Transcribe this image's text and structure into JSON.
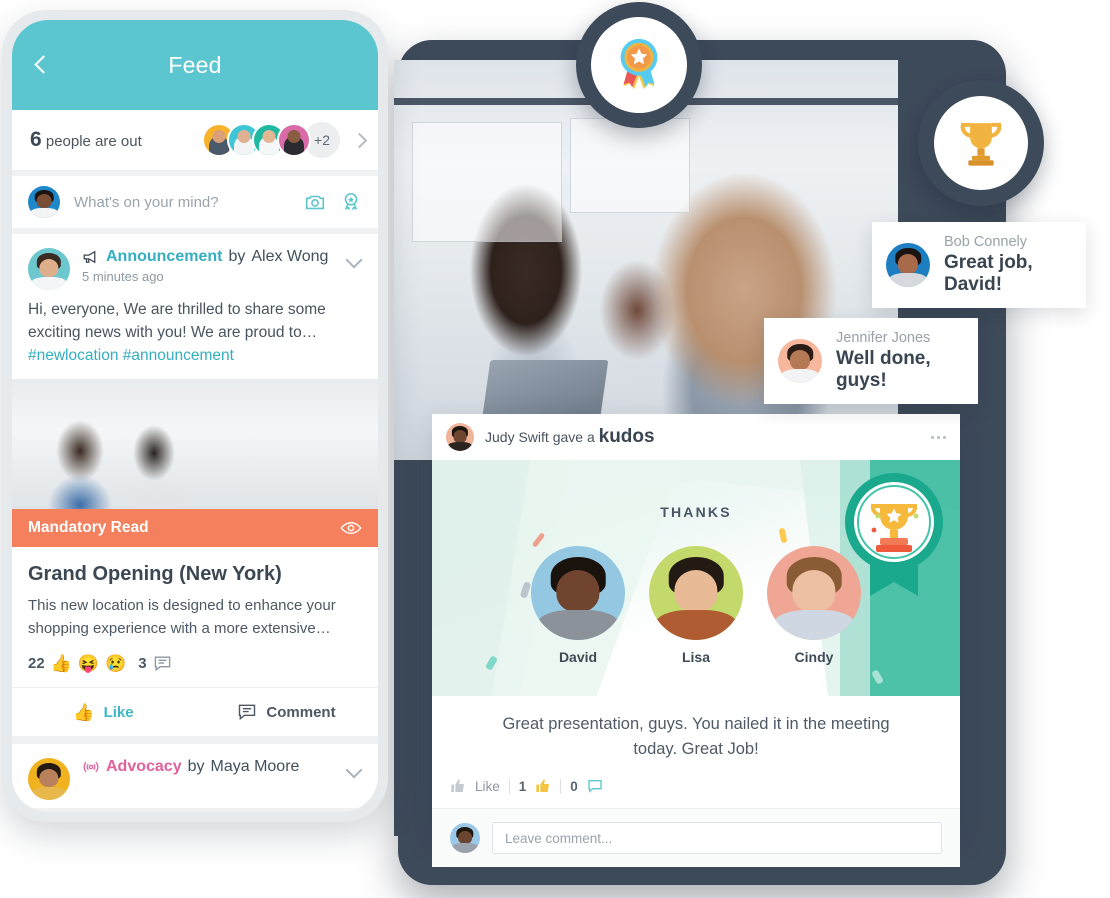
{
  "phone": {
    "header": {
      "title": "Feed",
      "back_icon": "chevron-left-icon"
    },
    "out_of_office": {
      "count": "6",
      "label": "people are out",
      "more_badge": "+2",
      "chevron_icon": "chevron-right-icon",
      "avatars": [
        {
          "name": "avatar-1",
          "bg": "#f7b32b",
          "skin": "#d9a07a",
          "hair": "#2f2620",
          "body": "#4a5a6b"
        },
        {
          "name": "avatar-2",
          "bg": "#3ec6d4",
          "skin": "#e0b093",
          "hair": "#2a211c",
          "body": "#f2f4f6"
        },
        {
          "name": "avatar-3",
          "bg": "#1fb8a0",
          "skin": "#e4b694",
          "hair": "#3b2f26",
          "body": "#f4f6f7"
        },
        {
          "name": "avatar-4",
          "bg": "#d96ca8",
          "skin": "#8a5c42",
          "hair": "#1d1714",
          "body": "#2b2a30"
        }
      ]
    },
    "composer": {
      "placeholder": "What's on your mind?",
      "camera_icon": "camera-icon",
      "badge_icon": "award-badge-icon"
    },
    "posts": [
      {
        "kind": "Announcement",
        "kind_class": "ann",
        "by_label": "by",
        "author": "Alex Wong",
        "time": "5 minutes ago",
        "icon": "megaphone-icon",
        "chevron_icon": "chevron-down-icon",
        "body": "Hi, everyone, We are thrilled to share some exciting news with you! We are proud to…",
        "tags": "#newlocation #announcement",
        "banner_label": "Mandatory Read",
        "banner_icon": "eye-icon",
        "banner_color": "#f5805e",
        "title": "Grand Opening (New York)",
        "subtitle": "This new location is designed to enhance your shopping experience with a more extensive…",
        "reaction_count": "22",
        "reaction_emojis": [
          "👍",
          "😝",
          "😢"
        ],
        "comment_count": "3",
        "comment_icon": "comment-icon",
        "like_label": "Like",
        "comment_label": "Comment"
      },
      {
        "kind": "Advocacy",
        "kind_class": "adv",
        "by_label": "by",
        "author": "Maya Moore",
        "icon": "broadcast-icon",
        "chevron_icon": "chevron-down-icon"
      }
    ]
  },
  "kudos_card": {
    "header": {
      "actor": "Judy Swift gave a",
      "type": "kudos",
      "menu_icon": "more-options-icon"
    },
    "banner": {
      "label": "THANKS",
      "badge_icon": "trophy-ribbon-badge-icon",
      "badge_color": "#1aa98c"
    },
    "recipients": [
      {
        "name": "David",
        "bg": "#93c7e2",
        "skin": "#70442e",
        "hair": "#1a120d",
        "body": "#8b929a"
      },
      {
        "name": "Lisa",
        "bg": "#c3d96b",
        "skin": "#e8bb96",
        "hair": "#241a14",
        "body": "#b05c33"
      },
      {
        "name": "Cindy",
        "bg": "#f0a694",
        "skin": "#edc0a3",
        "hair": "#8a5c35",
        "body": "#cfd8e2"
      }
    ],
    "message": "Great presentation, guys. You nailed it in the meeting today. Great Job!",
    "bar": {
      "like_label": "Like",
      "like_icon": "thumbs-up-icon",
      "like_count": "1",
      "like_count_icon": "thumbs-up-icon",
      "comment_count": "0",
      "comment_icon": "comment-icon"
    },
    "footer": {
      "placeholder": "Leave comment..."
    }
  },
  "medallions": [
    {
      "name": "star-ribbon-badge",
      "icon": "star-ribbon-icon"
    },
    {
      "name": "trophy-badge",
      "icon": "trophy-icon"
    }
  ],
  "bubbles": [
    {
      "who": "Bob Connely",
      "msg": "Great job, David!",
      "bg": "#1d7fc2",
      "skin": "#a86a4a",
      "hair": "#1b1410",
      "body": "#d6d9dd"
    },
    {
      "who": "Jennifer Jones",
      "msg": "Well done, guys!",
      "bg": "#f6b79c",
      "skin": "#b57a55",
      "hair": "#2b1d15",
      "body": "#f1f3f5"
    }
  ],
  "colors": {
    "teal": "#5bc6cf",
    "orange": "#f5805e",
    "navy": "#3d4a5a",
    "pink": "#e0619b",
    "green": "#1aa98c"
  }
}
